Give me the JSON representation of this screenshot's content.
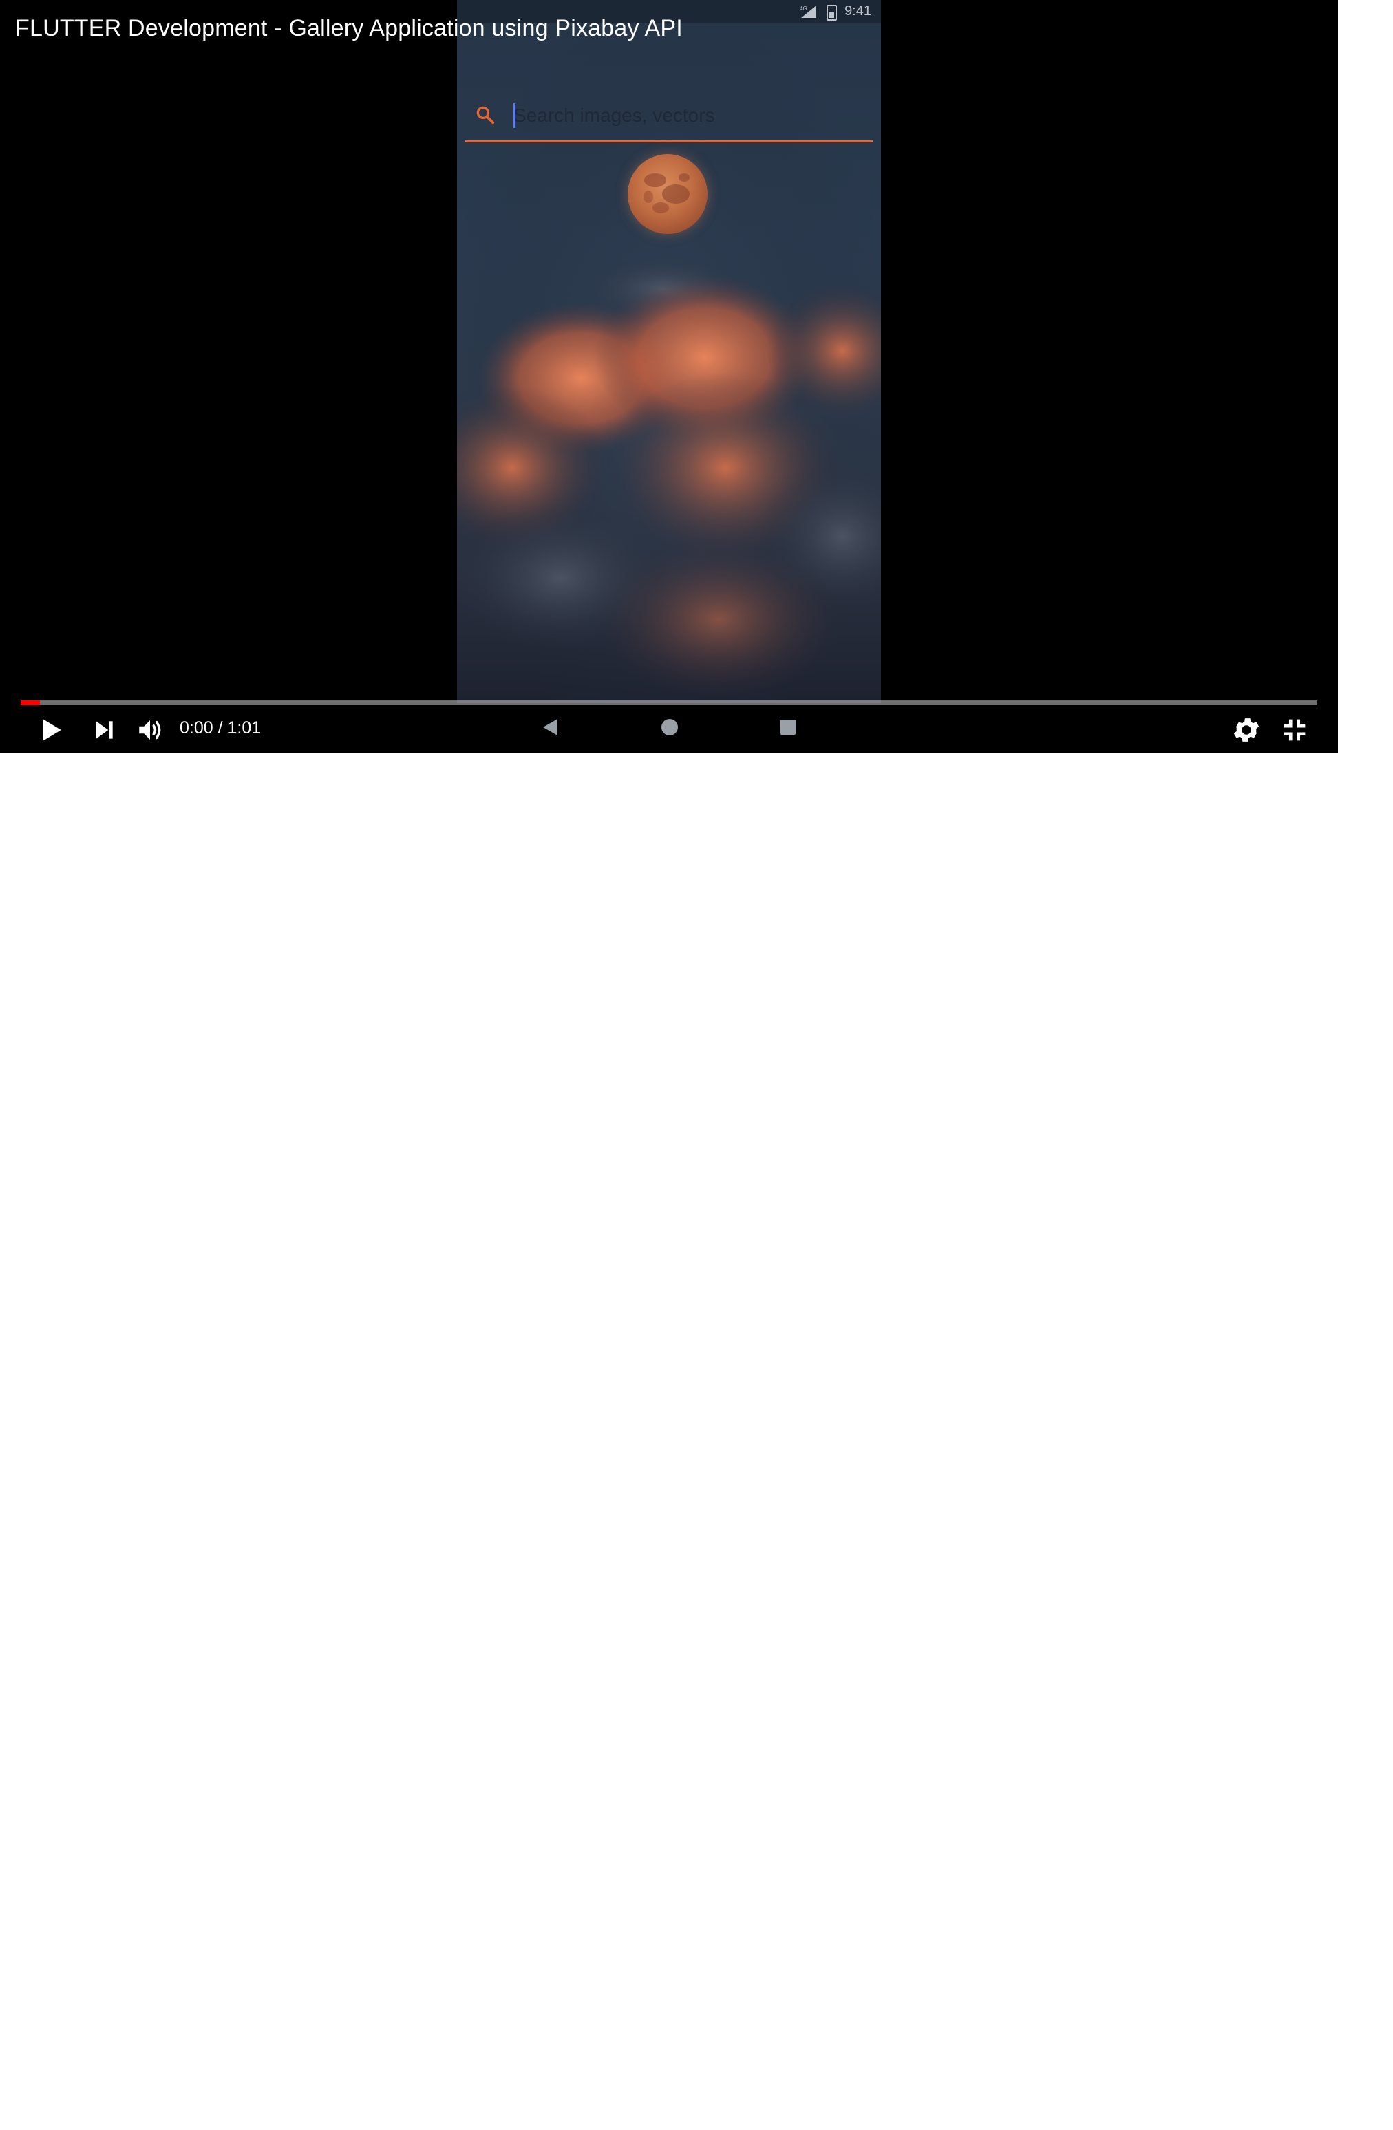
{
  "video": {
    "title": "FLUTTER Development - Gallery Application using Pixabay API",
    "current_time": "0:00",
    "separator": "/",
    "duration": "1:01",
    "progress": 0.015
  },
  "phone": {
    "status_time": "9:41",
    "signal_label": "4G",
    "search": {
      "placeholder": "Search images, vectors",
      "value": "",
      "accent_color": "#e8652f"
    },
    "nav_icons": [
      "back-triangle-icon",
      "home-circle-icon",
      "recents-square-icon"
    ]
  },
  "controls": {
    "icons": [
      "play-icon",
      "next-icon",
      "volume-icon",
      "gear-icon",
      "exit-fullscreen-icon"
    ],
    "progress_color": "#ff0000"
  }
}
